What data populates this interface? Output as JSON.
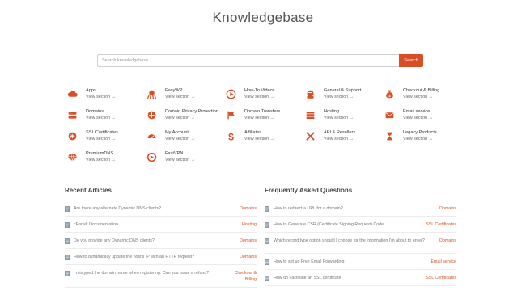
{
  "title": "Knowledgebase",
  "search": {
    "placeholder": "Search knowledgebase",
    "button": "Search"
  },
  "accent_color": "#d94f25",
  "categories": [
    {
      "name": "Apps",
      "link": "View section →",
      "icon": "cloud-icon"
    },
    {
      "name": "EasyWP",
      "link": "View section →",
      "icon": "octopus-icon"
    },
    {
      "name": "How-To Videos",
      "link": "View section →",
      "icon": "play-icon"
    },
    {
      "name": "General & Support",
      "link": "View section →",
      "icon": "support-icon"
    },
    {
      "name": "Checkout & Billing",
      "link": "View section →",
      "icon": "money-bag-icon"
    },
    {
      "name": "Domains",
      "link": "View section →",
      "icon": "server-icon"
    },
    {
      "name": "Domain Privacy Protection",
      "link": "View section →",
      "icon": "privacy-icon"
    },
    {
      "name": "Domain Transfers",
      "link": "View section →",
      "icon": "flag-icon"
    },
    {
      "name": "Hosting",
      "link": "View section →",
      "icon": "hosting-icon"
    },
    {
      "name": "Email service",
      "link": "View section →",
      "icon": "envelope-icon"
    },
    {
      "name": "SSL Certificates",
      "link": "View section →",
      "icon": "ssl-icon"
    },
    {
      "name": "My Account",
      "link": "View section →",
      "icon": "gauge-icon"
    },
    {
      "name": "Affiliates",
      "link": "View section →",
      "icon": "dollar-icon"
    },
    {
      "name": "API & Resellers",
      "link": "View section →",
      "icon": "tools-icon"
    },
    {
      "name": "Legacy Products",
      "link": "View section →",
      "icon": "hourglass-icon"
    },
    {
      "name": "PremiumDNS",
      "link": "View section →",
      "icon": "diamond-icon"
    },
    {
      "name": "FastVPN",
      "link": "View section →",
      "icon": "vpn-icon"
    }
  ],
  "recent_articles": {
    "heading": "Recent Articles",
    "items": [
      {
        "title": "Are there any alternate Dynamic DNS clients?",
        "tag": "Domains"
      },
      {
        "title": "cPanel: Documentation",
        "tag": "Hosting"
      },
      {
        "title": "Do you provide any Dynamic DNS clients?",
        "tag": "Domains"
      },
      {
        "title": "How to dynamically update the host's IP with an HTTP request?",
        "tag": "Domains"
      },
      {
        "title": "I mistyped the domain name when registering. Can you issue a refund?",
        "tag": "Checkout & Billing"
      }
    ]
  },
  "faq": {
    "heading": "Frequently Asked Questions",
    "items": [
      {
        "title": "How to redirect a URL for a domain?",
        "tag": "Domains"
      },
      {
        "title": "How to Generate CSR (Certificate Signing Request) Code",
        "tag": "SSL Certificates"
      },
      {
        "title": "Which record type option should I choose for the information I'm about to enter?",
        "tag": "Domains"
      },
      {
        "title": "How to set up Free Email Forwarding",
        "tag": "Email service"
      },
      {
        "title": "How do I activate an SSL certificate",
        "tag": "SSL Certificates"
      }
    ]
  }
}
